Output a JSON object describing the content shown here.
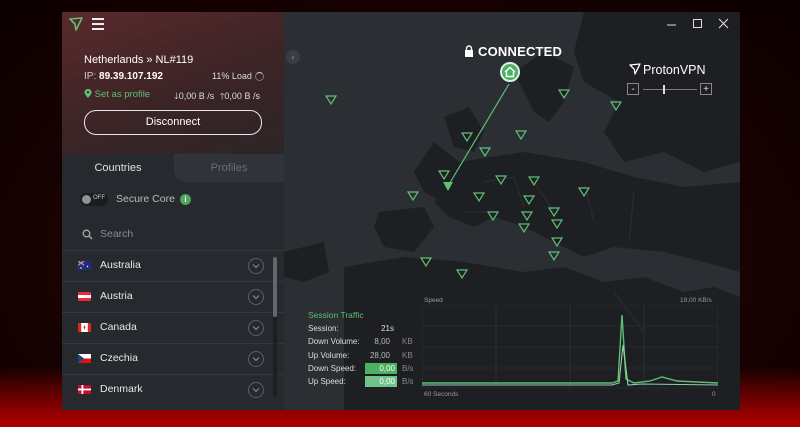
{
  "server": "Netherlands » NL#119",
  "ip_label": "IP:",
  "ip": "89.39.107.192",
  "load": "11% Load",
  "set_profile": "Set as profile",
  "down_rate": "0,00 B /s",
  "up_rate": "0,00 B /s",
  "disconnect": "Disconnect",
  "tabs": {
    "countries": "Countries",
    "profiles": "Profiles"
  },
  "secure_core": {
    "label": "Secure Core",
    "toggle": "OFF"
  },
  "search_placeholder": "Search",
  "countries": [
    {
      "name": "Australia"
    },
    {
      "name": "Austria"
    },
    {
      "name": "Canada"
    },
    {
      "name": "Czechia"
    },
    {
      "name": "Denmark"
    }
  ],
  "status": "CONNECTED",
  "brand": "ProtonVPN",
  "zoom": {
    "minus": "-",
    "plus": "+"
  },
  "traffic": {
    "title": "Session Traffic",
    "session_label": "Session:",
    "session_value": "21s",
    "down_volume_label": "Down Volume:",
    "down_volume_value": "8,00",
    "down_volume_unit": "KB",
    "up_volume_label": "Up Volume:",
    "up_volume_value": "28,00",
    "up_volume_unit": "KB",
    "down_speed_label": "Down Speed:",
    "down_speed_value": "0,00",
    "down_speed_unit": "B/s",
    "up_speed_label": "Up Speed:",
    "up_speed_value": "0,00",
    "up_speed_unit": "B/s"
  },
  "chart": {
    "speed_label": "Speed",
    "max_label": "19,00 KB/s",
    "time_label": "60 Seconds",
    "zero_label": "0"
  },
  "colors": {
    "accent": "#4caf62",
    "map_land": "#1d1f23",
    "map_sea": "#2b2e33"
  }
}
